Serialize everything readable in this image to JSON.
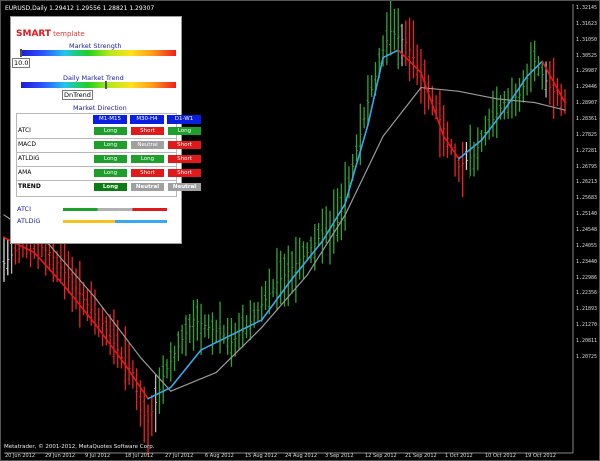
{
  "window": {
    "title": "EURUSD,Daily  1.29412 1.29556 1.28821 1.29307",
    "copyright": "Metatrader, © 2001-2012, MetaQuotes Software Corp."
  },
  "panel": {
    "brand": "SMART",
    "subtitle": "template",
    "market_strength": {
      "label": "Market Strength",
      "value": "10.0",
      "level": 0.0
    },
    "daily_trend": {
      "label": "Daily Market Trend",
      "value": "DnTrend",
      "level": 0.55
    },
    "market_direction": {
      "label": "Market Direction",
      "headers": [
        "M1-M15",
        "M30-H4",
        "D1-W1"
      ]
    },
    "rows": [
      {
        "name": "ATCI",
        "cells": [
          "Long",
          "Short",
          "Long"
        ]
      },
      {
        "name": "MACD",
        "cells": [
          "Long",
          "Neutral",
          "Short"
        ]
      },
      {
        "name": "ATLDiG",
        "cells": [
          "Long",
          "Long",
          "Short"
        ]
      },
      {
        "name": "AMA",
        "cells": [
          "Long",
          "Short",
          "Short"
        ]
      },
      {
        "name": "TREND",
        "cells": [
          "Long",
          "Neutral",
          "Neutral"
        ]
      }
    ],
    "legend": [
      {
        "name": "ATCI",
        "colors": [
          "#1e9e2a",
          "#b0b0b0",
          "#e01a1a"
        ]
      },
      {
        "name": "ATLDiG",
        "colors": [
          "#f7c21b",
          "#3aa8ee"
        ]
      }
    ]
  },
  "colors": {
    "long": "#1e9e2a",
    "short": "#e01a1a",
    "neutral": "#a0a0a0",
    "trend_long": "#0b7d14",
    "header": "#0a1ee0"
  },
  "chart_data": {
    "type": "line",
    "symbol": "EURUSD,Daily",
    "y_ticks": [
      "1.32145",
      "1.31050",
      "1.29987",
      "1.28907",
      "1.27825",
      "1.26795",
      "1.25683",
      "1.24548",
      "1.23440",
      "1.22356",
      "1.21270",
      "1.20725",
      "1.31623",
      "1.30525",
      "1.29446",
      "1.28361",
      "1.27281",
      "1.26213",
      "1.25140",
      "1.24055",
      "1.22986",
      "1.21893",
      "1.20811"
    ],
    "x_ticks": [
      "20 Jun 2012",
      "29 Jun 2012",
      "9 Jul 2012",
      "18 Jul 2012",
      "27 Jul 2012",
      "6 Aug 2012",
      "15 Aug 2012",
      "24 Aug 2012",
      "3 Sep 2012",
      "12 Sep 2012",
      "21 Sep 2012",
      "1 Oct 2012",
      "10 Oct 2012",
      "19 Oct 2012"
    ],
    "ylim": [
      1.2045,
      1.3243
    ],
    "close_path": [
      [
        0,
        1.255
      ],
      [
        3,
        1.262
      ],
      [
        6,
        1.258
      ],
      [
        9,
        1.25
      ],
      [
        11,
        1.244
      ],
      [
        13,
        1.239
      ],
      [
        15,
        1.232
      ],
      [
        16,
        1.228
      ],
      [
        17,
        1.226
      ],
      [
        18,
        1.216
      ],
      [
        19,
        1.213
      ],
      [
        20,
        1.218
      ],
      [
        21,
        1.225
      ],
      [
        23,
        1.233
      ],
      [
        25,
        1.24
      ],
      [
        27,
        1.238
      ],
      [
        29,
        1.236
      ],
      [
        30,
        1.234
      ],
      [
        32,
        1.238
      ],
      [
        34,
        1.244
      ],
      [
        36,
        1.25
      ],
      [
        38,
        1.254
      ],
      [
        40,
        1.258
      ],
      [
        42,
        1.263
      ],
      [
        44,
        1.266
      ],
      [
        45,
        1.272
      ],
      [
        46,
        1.281
      ],
      [
        48,
        1.298
      ],
      [
        50,
        1.312
      ],
      [
        51,
        1.317
      ],
      [
        53,
        1.314
      ],
      [
        55,
        1.306
      ],
      [
        57,
        1.296
      ],
      [
        59,
        1.286
      ],
      [
        60,
        1.281
      ],
      [
        62,
        1.284
      ],
      [
        64,
        1.292
      ],
      [
        66,
        1.298
      ],
      [
        68,
        1.3
      ],
      [
        70,
        1.309
      ],
      [
        72,
        1.302
      ],
      [
        74,
        1.298
      ]
    ],
    "ma_fast": [
      [
        0,
        1.262
      ],
      [
        4,
        1.258
      ],
      [
        8,
        1.249
      ],
      [
        12,
        1.239
      ],
      [
        16,
        1.228
      ],
      [
        19,
        1.219
      ],
      [
        22,
        1.222
      ],
      [
        26,
        1.232
      ],
      [
        30,
        1.236
      ],
      [
        34,
        1.24
      ],
      [
        38,
        1.251
      ],
      [
        42,
        1.261
      ],
      [
        45,
        1.271
      ],
      [
        48,
        1.292
      ],
      [
        50,
        1.31
      ],
      [
        52,
        1.312
      ],
      [
        55,
        1.306
      ],
      [
        58,
        1.289
      ],
      [
        60,
        1.283
      ],
      [
        63,
        1.288
      ],
      [
        66,
        1.296
      ],
      [
        69,
        1.305
      ],
      [
        71,
        1.309
      ],
      [
        74,
        1.298
      ]
    ],
    "ma_slow": [
      [
        0,
        1.268
      ],
      [
        6,
        1.26
      ],
      [
        12,
        1.246
      ],
      [
        18,
        1.23
      ],
      [
        22,
        1.221
      ],
      [
        28,
        1.226
      ],
      [
        34,
        1.238
      ],
      [
        40,
        1.252
      ],
      [
        45,
        1.268
      ],
      [
        50,
        1.289
      ],
      [
        55,
        1.302
      ],
      [
        60,
        1.301
      ],
      [
        65,
        1.299
      ],
      [
        70,
        1.298
      ],
      [
        74,
        1.296
      ]
    ]
  }
}
